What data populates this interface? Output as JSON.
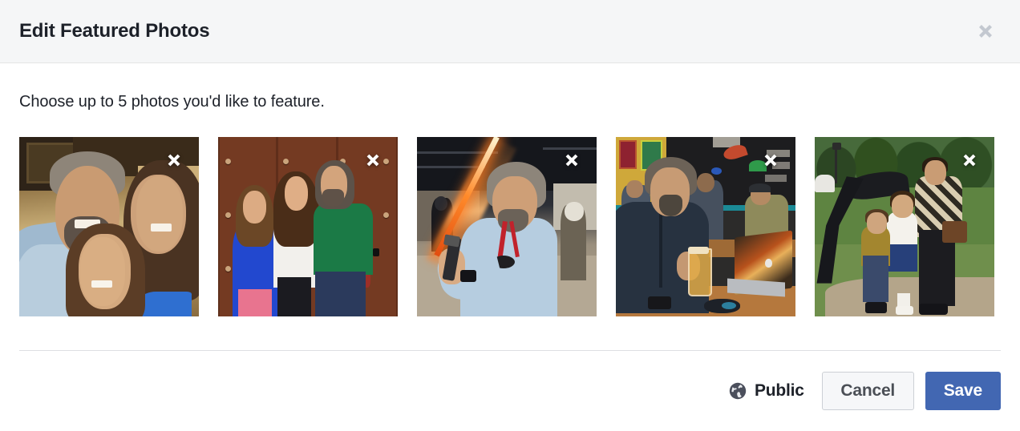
{
  "dialog": {
    "title": "Edit Featured Photos",
    "close_icon": "close-x-icon",
    "instruction": "Choose up to 5 photos you'd like to feature."
  },
  "photos": [
    {
      "remove_icon": "remove-x-icon",
      "alt": "Selfie of a man with two girls indoors"
    },
    {
      "remove_icon": "remove-x-icon",
      "alt": "Three people standing in front of wooden lockers"
    },
    {
      "remove_icon": "remove-x-icon",
      "alt": "Man holding a glowing lightsaber at a convention"
    },
    {
      "remove_icon": "remove-x-icon",
      "alt": "Man with a beer and laptop at a cafe"
    },
    {
      "remove_icon": "remove-x-icon",
      "alt": "Vintage park photo of a man with two children by a slide"
    }
  ],
  "footer": {
    "audience": {
      "icon": "globe-icon",
      "label": "Public"
    },
    "cancel_label": "Cancel",
    "save_label": "Save"
  },
  "colors": {
    "header_bg": "#f5f6f7",
    "title_text": "#1d2129",
    "close_icon": "#c3c8d0",
    "divider": "#dddfe2",
    "save_bg": "#4267b2",
    "save_text": "#ffffff",
    "cancel_bg": "#f6f7f9",
    "cancel_border": "#ccd0d5",
    "cancel_text": "#4b4f56",
    "globe_icon": "#4b4f5c"
  }
}
